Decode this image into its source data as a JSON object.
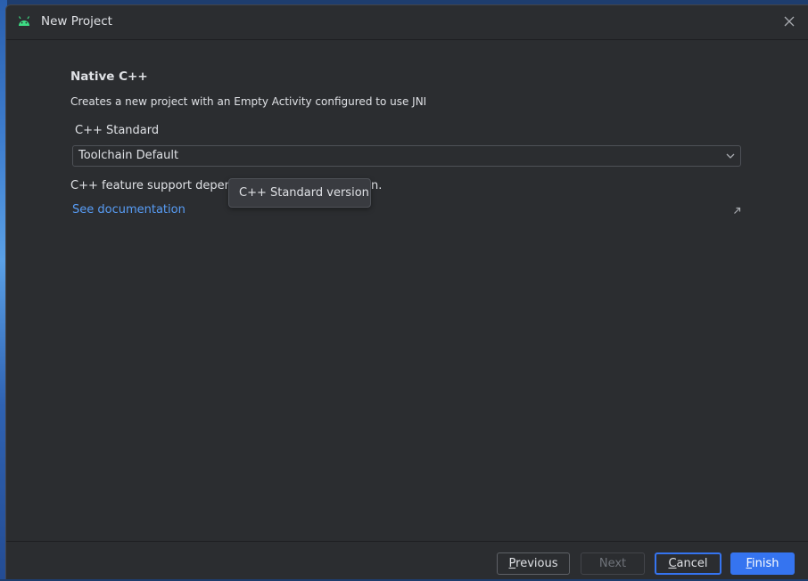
{
  "window": {
    "title": "New Project",
    "icon": "android-icon",
    "close_icon": "close-icon"
  },
  "template": {
    "heading": "Native C++",
    "description": "Creates a new project with an Empty Activity configured to use JNI"
  },
  "cpp_standard": {
    "label": "C++ Standard",
    "selected": "Toolchain Default"
  },
  "note": {
    "prefix": "C++ feature support depen",
    "suffix": "n."
  },
  "doc_link": "See documentation",
  "tooltip": "C++ Standard version",
  "buttons": {
    "previous_rest": "revious",
    "previous_mnemonic": "P",
    "next": "Next",
    "cancel_mnemonic": "C",
    "cancel_rest": "ancel",
    "finish_mnemonic": "F",
    "finish_rest": "inish"
  },
  "colors": {
    "background": "#2b2d30",
    "text": "#dfe1e5",
    "link": "#589df6",
    "accent": "#3574f0",
    "android_green": "#3ddc84"
  }
}
